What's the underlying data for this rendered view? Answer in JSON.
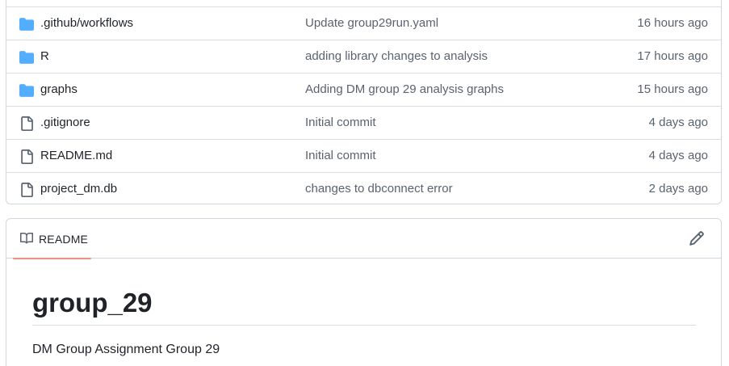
{
  "files": [
    {
      "type": "folder",
      "icon": "folder-icon",
      "name": ".github/workflows",
      "message": "Update group29run.yaml",
      "time": "16 hours ago"
    },
    {
      "type": "folder",
      "icon": "folder-icon",
      "name": "R",
      "message": "adding library changes to analysis",
      "time": "17 hours ago"
    },
    {
      "type": "folder",
      "icon": "folder-icon",
      "name": "graphs",
      "message": "Adding DM group 29 analysis graphs",
      "time": "15 hours ago"
    },
    {
      "type": "file",
      "icon": "file-icon",
      "name": ".gitignore",
      "message": "Initial commit",
      "time": "4 days ago"
    },
    {
      "type": "file",
      "icon": "file-icon",
      "name": "README.md",
      "message": "Initial commit",
      "time": "4 days ago"
    },
    {
      "type": "file",
      "icon": "file-icon",
      "name": "project_dm.db",
      "message": "changes to dbconnect error",
      "time": "2 days ago"
    }
  ],
  "readme": {
    "tab_label": "README",
    "tab_icon": "book-icon",
    "edit_icon": "pencil-icon",
    "title": "group_29",
    "description": "DM Group Assignment Group 29"
  },
  "colors": {
    "folder": "#54aeff",
    "file_icon": "#59636e",
    "tab_underline": "#fd8c73"
  }
}
